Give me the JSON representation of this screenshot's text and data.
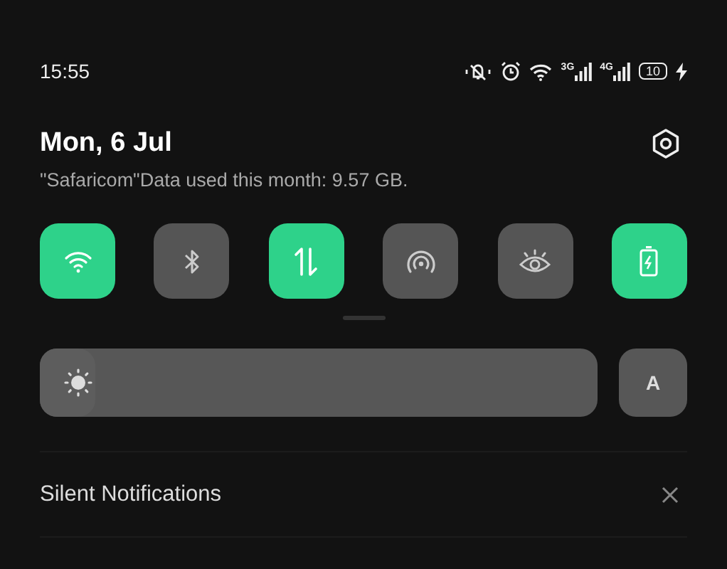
{
  "status_bar": {
    "time": "15:55",
    "network_1": "3G",
    "network_2": "4G",
    "battery": "10"
  },
  "header": {
    "date": "Mon, 6 Jul",
    "data_usage": "\"Safaricom\"Data used this month: 9.57 GB."
  },
  "tiles": [
    {
      "kind": "wifi",
      "on": true
    },
    {
      "kind": "bluetooth",
      "on": false
    },
    {
      "kind": "data",
      "on": true
    },
    {
      "kind": "hotspot",
      "on": false
    },
    {
      "kind": "eye",
      "on": false
    },
    {
      "kind": "battery",
      "on": true
    }
  ],
  "brightness": {
    "level": 0.1,
    "auto_label": "A"
  },
  "notifications": {
    "title": "Silent Notifications"
  }
}
